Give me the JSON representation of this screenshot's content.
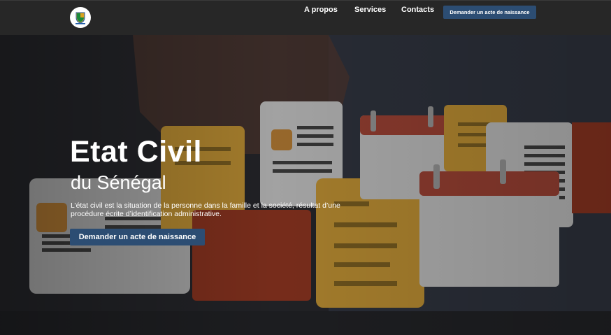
{
  "navbar": {
    "logo_icon": "senegal-coat-of-arms-icon",
    "links": [
      {
        "label": "A propos"
      },
      {
        "label": "Services"
      },
      {
        "label": "Contacts"
      }
    ],
    "cta_label": "Demander un acte de naissance"
  },
  "hero": {
    "title": "Etat Civil",
    "subtitle": "du Sénégal",
    "description": "L’état civil est la situation de la personne dans la famille et la société, résultat d’une procédure écrite d’identification administrative.",
    "cta_label": "Demander un acte de naissance",
    "background_image": "documents-illustration"
  },
  "colors": {
    "accent": "#2c4d73",
    "navbar_bg": "#272727"
  }
}
